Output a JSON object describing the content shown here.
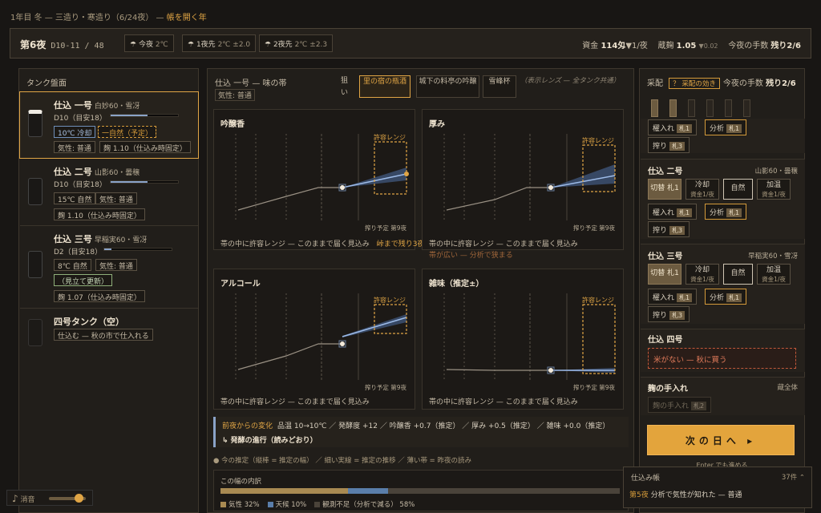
{
  "topline": {
    "prefix": "1年目 冬 — 三造り・寒造り（6/24夜） —",
    "highlight": "帳を開く年"
  },
  "header": {
    "night": "第6夜",
    "day_range": "D10-11 / 48",
    "weather": [
      {
        "icon": "umbrella-icon",
        "label": "今夜",
        "temp": "2℃",
        "sd": ""
      },
      {
        "icon": "umbrella-icon",
        "label": "1夜先",
        "temp": "2℃",
        "sd": "±2.0"
      },
      {
        "icon": "umbrella-icon",
        "label": "2夜先",
        "temp": "2℃",
        "sd": "±2.3"
      }
    ],
    "funds_label": "資金",
    "funds": "114匁",
    "funds_delta": "▼1/夜",
    "koji_label": "蔵麹",
    "koji": "1.05",
    "koji_delta": "▼0.02",
    "moves_label": "今夜の手数",
    "moves": "残り2/6"
  },
  "tank_panel": {
    "title": "タンク盤面",
    "tanks": [
      {
        "name": "仕込 一号",
        "rice": "白妙60・雪冴",
        "day": "D10（目安18）",
        "progress": 0.55,
        "tags": [
          "10℃ 冷却",
          "一自然（予定）",
          "気性: 普通",
          "麹 1.10（仕込み時固定）"
        ]
      },
      {
        "name": "仕込 二号",
        "rice": "山影60・曇穣",
        "day": "D10（目安18）",
        "progress": 0.55,
        "tags": [
          "15℃ 自然",
          "気性: 普通",
          "麹 1.10（仕込み時固定）"
        ]
      },
      {
        "name": "仕込 三号",
        "rice": "早稲実60・雪冴",
        "day": "D2（目安18）",
        "progress": 0.11,
        "tags": [
          "8℃ 自然",
          "気性: 普通",
          "（見立て更新）",
          "麹 1.07（仕込み時固定）"
        ]
      },
      {
        "name": "四号タンク（空）",
        "rice": "",
        "day": "",
        "tags": [
          "仕込む — 秋の市で仕入れる"
        ]
      }
    ]
  },
  "center": {
    "title": "仕込 一号 — 味の帯",
    "temper": "気性: 普通",
    "aim_label": "狙い",
    "lenses": [
      "里の宿の瓶酒",
      "城下の料亭の吟醸",
      "雪峰杯"
    ],
    "lens_note": "（表示レンズ — 全タンク共通）",
    "charts": [
      {
        "title": "吟醸香",
        "tol_label": "許容レンジ",
        "sched": "搾り予定 第9夜",
        "note": "帯の中に許容レンジ — このままで届く見込み",
        "note_hl": "峠まで残り3夜",
        "note2": ""
      },
      {
        "title": "厚み",
        "tol_label": "許容レンジ",
        "sched": "搾り予定 第9夜",
        "note": "帯の中に許容レンジ — このままで届く見込み",
        "note_hl": "",
        "note2": "帯が広い — 分析で狭まる"
      },
      {
        "title": "アルコール",
        "tol_label": "許容レンジ",
        "sched": "搾り予定 第9夜",
        "note": "帯の中に許容レンジ — このままで届く見込み",
        "note_hl": "",
        "note2": ""
      },
      {
        "title": "雑味（推定±）",
        "tol_label": "許容レンジ",
        "sched": "搾り予定 第9夜",
        "note": "帯の中に許容レンジ — このままで届く見込み",
        "note_hl": "",
        "note2": ""
      }
    ],
    "changes_title": "前夜からの変化",
    "changes": "品温 10→10℃ ／ 発酵度 +12 ／ 吟醸香 +0.7（推定） ／ 厚み +0.5（推定） ／ 雑味 +0.0（推定）",
    "changes2": "↳ 発酵の進行（読みどおり）",
    "legend": "● 今の推定（縦棒 = 推定の幅） ／ 細い実線 = 推定の推移 ／ 薄い帯 = 昨夜の読み",
    "breakdown_title": "この幅の内訳",
    "breakdown": [
      {
        "label": "気性 32%",
        "value": 32,
        "color": "#a88a52"
      },
      {
        "label": "天候 10%",
        "value": 10,
        "color": "#5a7eaa"
      },
      {
        "label": "観測不足（分析で減る） 58%",
        "value": 58,
        "color": "#4a433a"
      }
    ]
  },
  "right_panel": {
    "title": "采配",
    "help": "？ 采配の効き",
    "moves_label": "今夜の手数",
    "moves": "残り2/6",
    "tokens_used": 2,
    "tokens_total": 6,
    "tank1": {
      "buttons": [
        "櫂入れ",
        "分析",
        "搾り"
      ],
      "tickets": [
        "札1",
        "札1",
        "札3"
      ]
    },
    "tank2": {
      "name": "仕込 二号",
      "rice": "山影60・曇穣",
      "temp": [
        {
          "l": "切替 札1",
          "s": ""
        },
        {
          "l": "冷却",
          "s": "資金1/夜"
        },
        {
          "l": "自然",
          "s": ""
        },
        {
          "l": "加温",
          "s": "資金1/夜"
        }
      ],
      "buttons": [
        "櫂入れ",
        "分析",
        "搾り"
      ],
      "tickets": [
        "札1",
        "札1",
        "札3"
      ]
    },
    "tank3": {
      "name": "仕込 三号",
      "rice": "早稲実60・雪冴",
      "temp": [
        {
          "l": "切替 札1",
          "s": ""
        },
        {
          "l": "冷却",
          "s": "資金1/夜"
        },
        {
          "l": "自然",
          "s": ""
        },
        {
          "l": "加温",
          "s": "資金1/夜"
        }
      ],
      "buttons": [
        "櫂入れ",
        "分析",
        "搾り"
      ],
      "tickets": [
        "札1",
        "札1",
        "札3"
      ]
    },
    "tank4": {
      "name": "仕込 四号",
      "warning": "米がない — 秋に買う"
    },
    "koji": {
      "name": "麹の手入れ",
      "scope": "蔵全体",
      "button": "麹の手入れ",
      "ticket": "札2"
    },
    "next": "次の日へ ▸",
    "next_hint": "Enter でも進める"
  },
  "journal": {
    "title": "仕込み帳",
    "count": "37件",
    "night": "第5夜",
    "entry": "分析で気性が知れた — 普通"
  },
  "sound": {
    "label": "消音",
    "volume": 0.7
  }
}
